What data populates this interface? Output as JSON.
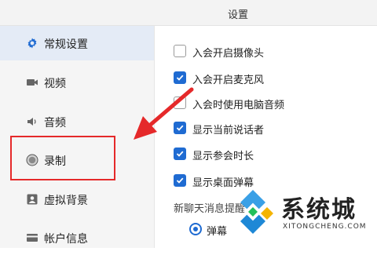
{
  "window": {
    "title": "设置"
  },
  "sidebar": {
    "items": [
      {
        "label": "常规设置",
        "icon": "gear-icon",
        "active": true
      },
      {
        "label": "视频",
        "icon": "video-camera-icon",
        "active": false
      },
      {
        "label": "音频",
        "icon": "speaker-icon",
        "active": false
      },
      {
        "label": "录制",
        "icon": "record-icon",
        "active": false
      },
      {
        "label": "虚拟背景",
        "icon": "portrait-icon",
        "active": false
      },
      {
        "label": "帐户信息",
        "icon": "id-card-icon",
        "active": false
      }
    ]
  },
  "main": {
    "options": [
      {
        "label": "入会开启摄像头",
        "checked": false
      },
      {
        "label": "入会开启麦克风",
        "checked": true
      },
      {
        "label": "入会时使用电脑音频",
        "checked": false
      },
      {
        "label": "显示当前说话者",
        "checked": true
      },
      {
        "label": "显示参会时长",
        "checked": true
      },
      {
        "label": "显示桌面弹幕",
        "checked": true
      }
    ],
    "chat_section_label": "新聊天消息提醒",
    "chat_radio": {
      "label": "弹幕",
      "selected": true
    }
  },
  "watermark": {
    "name": "系统城",
    "url": "XITONGCHENG.COM"
  },
  "colors": {
    "accent": "#1f6bd2",
    "annotation_red": "#e5292a",
    "active_bg": "#e4ebf6"
  }
}
